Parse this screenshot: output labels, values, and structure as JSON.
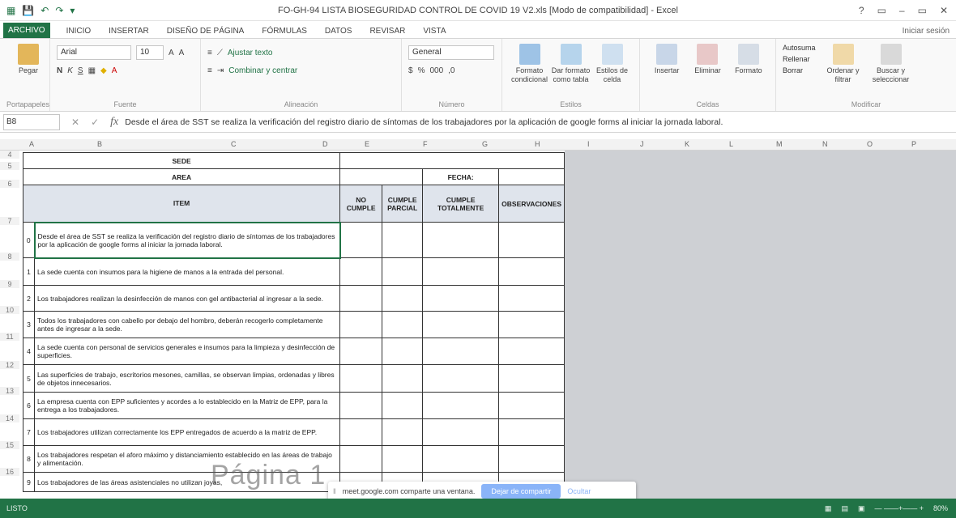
{
  "window": {
    "title": "FO-GH-94 LISTA BIOSEGURIDAD CONTROL DE COVID 19 V2.xls [Modo de compatibilidad] - Excel",
    "controls": [
      "?",
      "▭",
      "–",
      "▭",
      "✕"
    ]
  },
  "qat": [
    "▦",
    "💾",
    "↶",
    "↷",
    "▾"
  ],
  "tabs": [
    "ARCHIVO",
    "INICIO",
    "INSERTAR",
    "DISEÑO DE PÁGINA",
    "FÓRMULAS",
    "DATOS",
    "REVISAR",
    "VISTA"
  ],
  "signin": "Iniciar sesión",
  "ribbon": {
    "paste": "Pegar",
    "clipboard": "Portapapeles",
    "font_name": "Arial",
    "font_size": "10",
    "font_group": "Fuente",
    "wrap": "Ajustar texto",
    "merge": "Combinar y centrar",
    "align_group": "Alineación",
    "number_format": "General",
    "number_group": "Número",
    "cond_format": "Formato condicional",
    "as_table": "Dar formato como tabla",
    "cell_styles": "Estilos de celda",
    "styles_group": "Estilos",
    "insert": "Insertar",
    "delete": "Eliminar",
    "format": "Formato",
    "cells_group": "Celdas",
    "autosum": "Autosuma",
    "fill": "Rellenar",
    "clear": "Borrar",
    "sort": "Ordenar y filtrar",
    "find": "Buscar y seleccionar",
    "edit_group": "Modificar"
  },
  "formula_bar": {
    "cell": "B8",
    "fx": "fx",
    "content": "Desde el área de SST se realiza la verificación del registro diario de síntomas de los trabajadores por la aplicación de google forms al iniciar la jornada laboral."
  },
  "columns": [
    "A",
    "B",
    "C",
    "D",
    "E",
    "F",
    "G",
    "H",
    "I",
    "J",
    "K",
    "L",
    "M",
    "N",
    "O",
    "P"
  ],
  "rows": [
    "4",
    "5",
    "6",
    "7",
    "8",
    "9",
    "10",
    "11",
    "12",
    "13",
    "14",
    "15",
    "16"
  ],
  "sheet": {
    "sede_label": "SEDE",
    "area_label": "AREA",
    "fecha_label": "FECHA:",
    "headers": {
      "item": "ITEM",
      "no_cumple": "NO CUMPLE",
      "cumple_parcial": "CUMPLE PARCIAL",
      "cumple_total": "CUMPLE TOTALMENTE",
      "observaciones": "OBSERVACIONES"
    },
    "items": [
      {
        "n": "0",
        "text": "Desde el área de SST se realiza la verificación del registro diario de síntomas de los trabajadores por la aplicación de google forms al iniciar la jornada laboral."
      },
      {
        "n": "1",
        "text": "La sede cuenta con insumos para la higiene de manos a la entrada del personal."
      },
      {
        "n": "2",
        "text": "Los trabajadores realizan la desinfección de manos con gel antibacterial al ingresar a la sede."
      },
      {
        "n": "3",
        "text": "Todos los trabajadores con cabello por debajo del hombro, deberán recogerlo completamente antes de ingresar a la sede."
      },
      {
        "n": "4",
        "text": "La sede cuenta con personal de servicios generales e insumos para la limpieza y desinfección de superficies."
      },
      {
        "n": "5",
        "text": "Las superficies de trabajo, escritorios mesones, camillas, se observan limpias, ordenadas y libres de objetos innecesarios."
      },
      {
        "n": "6",
        "text": "La empresa cuenta con EPP suficientes y acordes a lo establecido en la Matriz de EPP, para la entrega a los trabajadores."
      },
      {
        "n": "7",
        "text": "Los trabajadores utilizan correctamente los EPP entregados de acuerdo a la matriz de EPP."
      },
      {
        "n": "8",
        "text": "Los trabajadores respetan el aforo máximo y distanciamiento establecido en las áreas de trabajo y alimentación."
      },
      {
        "n": "9",
        "text": "Los trabajadores de las áreas asistenciales no utilizan joyas,"
      }
    ]
  },
  "watermark": "Página 1",
  "meet": {
    "message": "meet.google.com comparte una ventana.",
    "stop": "Dejar de compartir",
    "hide": "Ocultar"
  },
  "status": {
    "text": "LISTO",
    "zoom": "80%"
  },
  "colors": {
    "excel_green": "#217346"
  }
}
